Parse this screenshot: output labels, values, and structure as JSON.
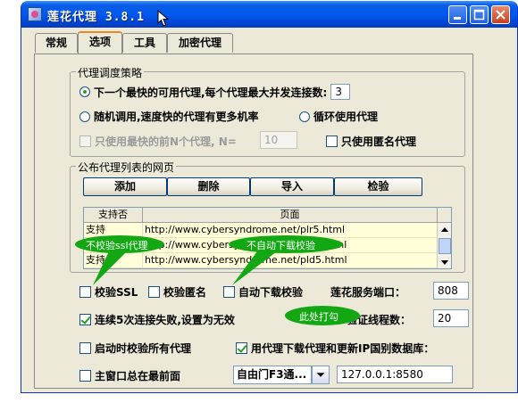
{
  "window": {
    "title": "莲花代理 3.8.1",
    "controls": [
      "minimize-icon",
      "maximize-icon",
      "close-icon"
    ]
  },
  "tabs": [
    {
      "label": "常规",
      "active": false
    },
    {
      "label": "选项",
      "active": true
    },
    {
      "label": "工具",
      "active": false
    },
    {
      "label": "加密代理",
      "active": false
    }
  ],
  "strategy": {
    "legend": "代理调度策略",
    "opt_fastest": "下一个最快的可用代理,每个代理最大并发连接数:",
    "max_conn": "3",
    "opt_random": "随机调用,速度快的代理有更多机率",
    "opt_cycle": "循环使用代理",
    "only_fastest_label": "只使用最快的前N个代理, N=",
    "n_value": "10",
    "only_anon_label": "只使用匿名代理"
  },
  "publish": {
    "legend": "公布代理列表的网页",
    "buttons": [
      "添加",
      "删除",
      "导入",
      "检验"
    ],
    "columns": [
      "支持否",
      "页面"
    ],
    "rows": [
      {
        "support": "支持",
        "page": "http://www.cybersyndrome.net/plr5.html"
      },
      {
        "support": "支持",
        "page": "http://www.cybersyndrome.net/pla5.html"
      },
      {
        "support": "支持",
        "page": "http://www.cybersyndrome.net/pld5.html"
      }
    ]
  },
  "options": {
    "verify_ssl": "校验SSL",
    "verify_anon": "校验匿名",
    "auto_download_verify": "自动下载校验",
    "port_label": "莲花服务端口：",
    "port_value": "808",
    "fail_invalid": "连续5次连接失败,设置为无效",
    "threads_label": "验证线程数：",
    "threads_value": "20",
    "verify_on_start": "启动时校验所有代理",
    "use_proxy_update": "用代理下载代理和更新IP国别数据库：",
    "always_on_top": "主窗口总在最前面",
    "combo_value": "自由门F3通...",
    "proxy_address": "127.0.0.1:8580"
  },
  "annotations": {
    "no_ssl": "不校验ssl代理",
    "no_auto": "不自动下载校验",
    "check_here": "此处打勾"
  },
  "colors": {
    "title_blue": "#0058ee",
    "bubble_green": "#13a813",
    "row_yellow": "#fffed9",
    "tab_accent": "#e68b2c"
  }
}
